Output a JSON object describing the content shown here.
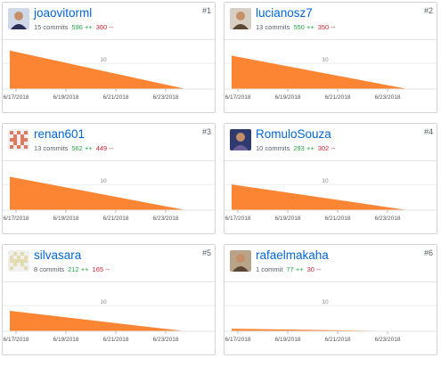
{
  "chart_axes": {
    "x_ticks": [
      "6/17/2018",
      "6/19/2018",
      "6/21/2018",
      "6/23/2018"
    ],
    "y_tick": "10",
    "series_color": "#fb8532"
  },
  "contributors": [
    {
      "rank": "#1",
      "username": "joaovitorml",
      "commits": "15 commits",
      "additions": "596 ++",
      "deletions": "360 --",
      "avatar": "photo-avatar"
    },
    {
      "rank": "#2",
      "username": "lucianosz7",
      "commits": "13 commits",
      "additions": "550 ++",
      "deletions": "350 --",
      "avatar": "photo-avatar"
    },
    {
      "rank": "#3",
      "username": "renan601",
      "commits": "13 commits",
      "additions": "562 ++",
      "deletions": "449 --",
      "avatar": "identicon-avatar"
    },
    {
      "rank": "#4",
      "username": "RomuloSouza",
      "commits": "10 commits",
      "additions": "293 ++",
      "deletions": "302 --",
      "avatar": "photo-avatar"
    },
    {
      "rank": "#5",
      "username": "silvasara",
      "commits": "8 commits",
      "additions": "212 ++",
      "deletions": "165 --",
      "avatar": "identicon-avatar"
    },
    {
      "rank": "#6",
      "username": "rafaelmakaha",
      "commits": "1 commit",
      "additions": "77 ++",
      "deletions": "30 --",
      "avatar": "photo-avatar"
    }
  ],
  "chart_data": [
    {
      "type": "area",
      "x": [
        "6/17/2018",
        "6/23/2018"
      ],
      "values": [
        15,
        0
      ],
      "ylabel": "",
      "xlabel": "",
      "y_ticks": [
        10
      ]
    },
    {
      "type": "area",
      "x": [
        "6/17/2018",
        "6/23/2018"
      ],
      "values": [
        13,
        0
      ],
      "ylabel": "",
      "xlabel": "",
      "y_ticks": [
        10
      ]
    },
    {
      "type": "area",
      "x": [
        "6/17/2018",
        "6/23/2018"
      ],
      "values": [
        13,
        0
      ],
      "ylabel": "",
      "xlabel": "",
      "y_ticks": [
        10
      ]
    },
    {
      "type": "area",
      "x": [
        "6/17/2018",
        "6/23/2018"
      ],
      "values": [
        10,
        0
      ],
      "ylabel": "",
      "xlabel": "",
      "y_ticks": [
        10
      ]
    },
    {
      "type": "area",
      "x": [
        "6/17/2018",
        "6/23/2018"
      ],
      "values": [
        8,
        0
      ],
      "ylabel": "",
      "xlabel": "",
      "y_ticks": [
        10
      ]
    },
    {
      "type": "area",
      "x": [
        "6/17/2018",
        "6/23/2018"
      ],
      "values": [
        1,
        0
      ],
      "ylabel": "",
      "xlabel": "",
      "y_ticks": [
        10
      ]
    }
  ]
}
